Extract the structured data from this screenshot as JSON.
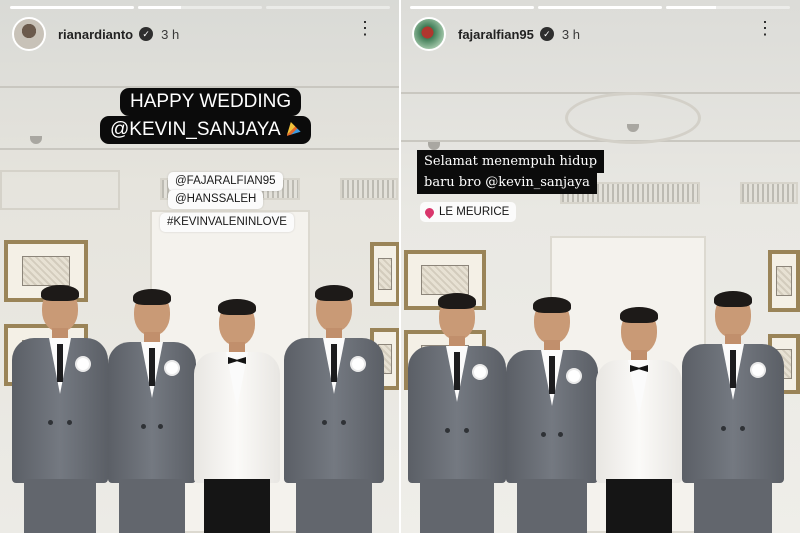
{
  "left_story": {
    "username": "rianardianto",
    "time": "3 h",
    "progress": [
      1.0,
      0.35,
      0
    ],
    "headline_line1": "HAPPY WEDDING",
    "headline_line2": "@KEVIN_SANJAYA",
    "mentions": [
      "@FAJARALFIAN95",
      "@HANSSALEH"
    ],
    "hashtag": "#KEVINVALENINLOVE"
  },
  "right_story": {
    "username": "fajaralfian95",
    "time": "3 h",
    "progress": [
      1.0,
      1.0,
      0.4
    ],
    "caption_line1": "Selamat menempuh hidup",
    "caption_line2": "baru bro @kevin_sanjaya",
    "location": "LE MEURICE"
  },
  "icons": {
    "verified": "verified-badge-icon",
    "more": "more-options-icon",
    "location_pin": "location-pin-icon",
    "party": "party-popper-icon"
  },
  "colors": {
    "tag_bg": "#0b0b0b",
    "sticker_bg": "#fbfbfb",
    "pin": "#d9366c"
  }
}
